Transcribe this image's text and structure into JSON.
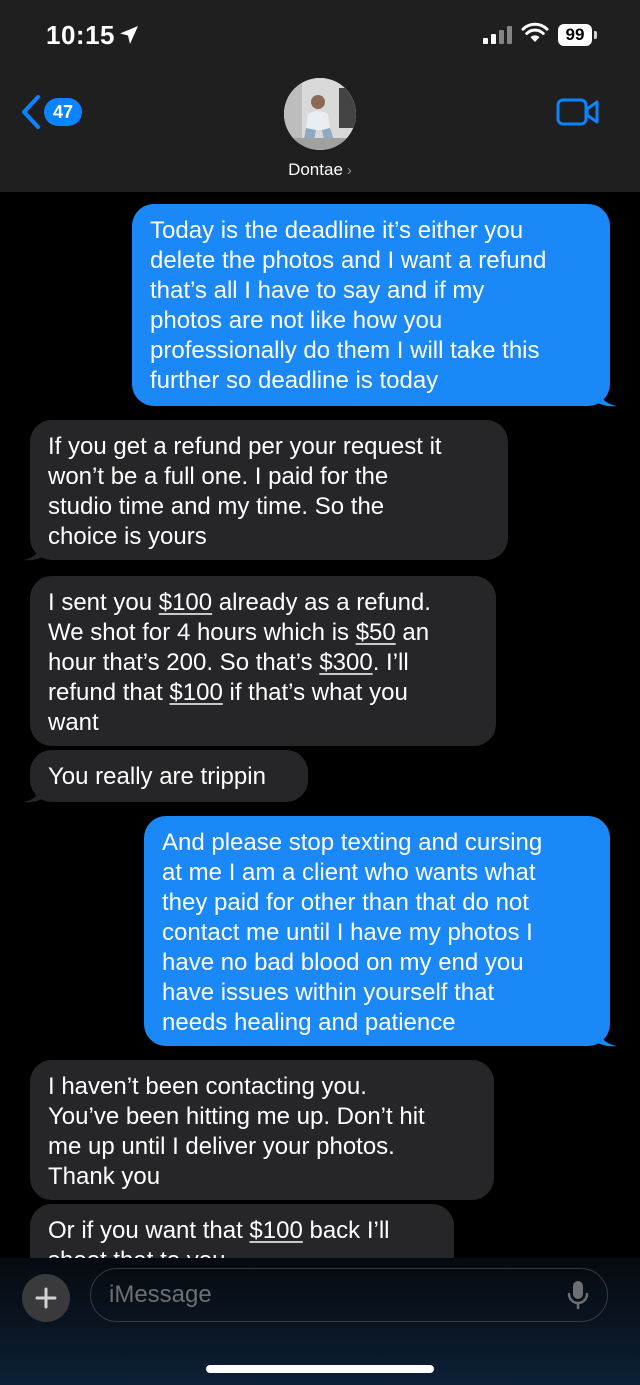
{
  "status_bar": {
    "time": "10:15",
    "battery": "99"
  },
  "header": {
    "back_count": "47",
    "contact_name": "Dontae",
    "accent_color": "#0a84ff"
  },
  "messages": [
    {
      "side": "outgoing",
      "lines": [
        "Today is the deadline it’s either you",
        "delete the photos and I want a refund",
        "that’s all I have to say and if my",
        "photos are not like how you",
        "professionally do them I will take this",
        "further so deadline is today"
      ]
    },
    {
      "side": "incoming",
      "lines": [
        "If you get a refund per your request it",
        "won’t be a full one. I paid for the",
        "studio time and my time. So the",
        "choice is yours"
      ]
    },
    {
      "side": "incoming",
      "lines": [
        [
          "I sent you ",
          {
            "u": "$100"
          },
          " already as a refund."
        ],
        [
          "We shot for 4 hours which is ",
          {
            "u": "$50"
          },
          " an"
        ],
        [
          "hour that’s 200. So that’s ",
          {
            "u": "$300"
          },
          ". I’ll"
        ],
        [
          "refund that ",
          {
            "u": "$100"
          },
          " if that’s what you"
        ],
        "want"
      ]
    },
    {
      "side": "incoming",
      "lines": [
        "You really are trippin"
      ]
    },
    {
      "side": "outgoing",
      "lines": [
        "And please stop texting and cursing",
        "at me I am a client who wants what",
        "they paid for other than that do not",
        "contact me until I have my photos I",
        "have no bad blood on my end you",
        "have issues within yourself that",
        "needs healing and patience"
      ]
    },
    {
      "side": "incoming",
      "lines": [
        "I haven’t been contacting you.",
        "You’ve been hitting me up. Don’t hit",
        "me up until I deliver your photos.",
        "Thank you"
      ]
    },
    {
      "side": "incoming",
      "lines": [
        [
          "Or if you want that ",
          {
            "u": "$100"
          },
          " back I’ll"
        ],
        "shoot that to you"
      ]
    }
  ],
  "composer": {
    "placeholder": "iMessage"
  },
  "icons": [
    "location-arrow-icon",
    "signal-icon",
    "wifi-icon",
    "battery-icon",
    "back-chevron-icon",
    "video-camera-icon",
    "plus-icon",
    "microphone-icon"
  ]
}
